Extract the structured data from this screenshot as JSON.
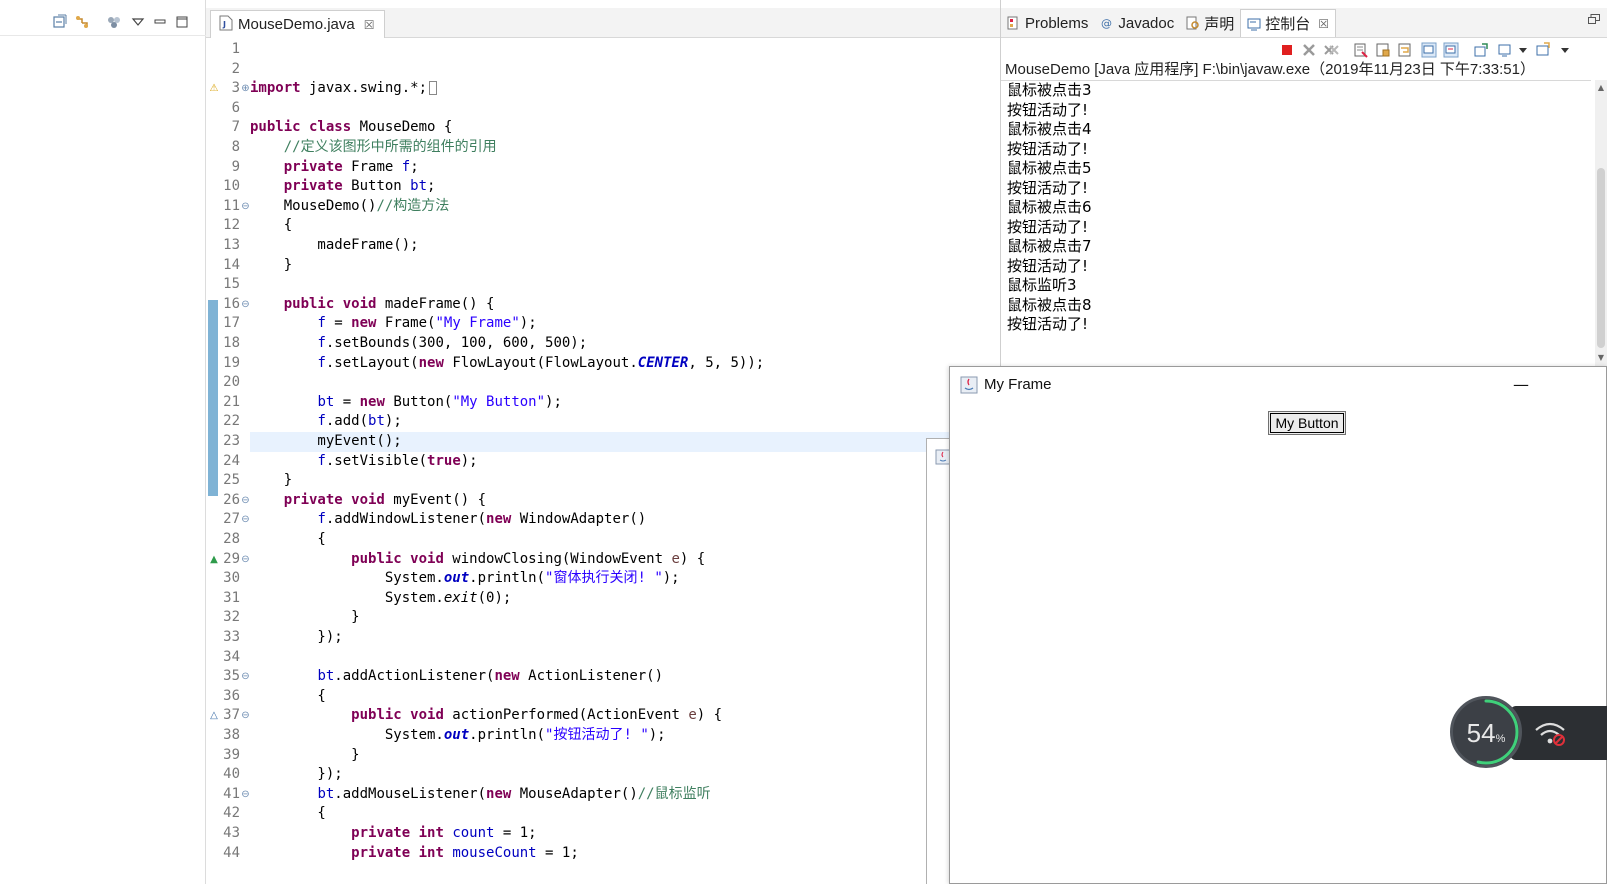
{
  "editor": {
    "tab_title": "MouseDemo.java",
    "tab_close": "☒",
    "lines": [
      {
        "n": "1",
        "tokens": []
      },
      {
        "n": "2",
        "tokens": []
      },
      {
        "n": "3",
        "fold": "⊕",
        "marker": "warn",
        "tokens": [
          {
            "t": "import",
            "c": "kw"
          },
          {
            "t": " javax.swing.*;",
            "c": "pl"
          },
          {
            "t": "",
            "c": "box"
          }
        ]
      },
      {
        "n": "6",
        "tokens": []
      },
      {
        "n": "7",
        "tokens": [
          {
            "t": "public class",
            "c": "kw"
          },
          {
            "t": " MouseDemo {",
            "c": "pl"
          }
        ]
      },
      {
        "n": "8",
        "tokens": [
          {
            "t": "    ",
            "c": "pl"
          },
          {
            "t": "//定义该图形中所需的组件的引用",
            "c": "com"
          }
        ]
      },
      {
        "n": "9",
        "tokens": [
          {
            "t": "    ",
            "c": "pl"
          },
          {
            "t": "private",
            "c": "kw"
          },
          {
            "t": " Frame ",
            "c": "pl"
          },
          {
            "t": "f",
            "c": "fld"
          },
          {
            "t": ";",
            "c": "pl"
          }
        ]
      },
      {
        "n": "10",
        "tokens": [
          {
            "t": "    ",
            "c": "pl"
          },
          {
            "t": "private",
            "c": "kw"
          },
          {
            "t": " Button ",
            "c": "pl"
          },
          {
            "t": "bt",
            "c": "fld"
          },
          {
            "t": ";",
            "c": "pl"
          }
        ]
      },
      {
        "n": "11",
        "fold": "⊖",
        "tokens": [
          {
            "t": "    MouseDemo()",
            "c": "pl"
          },
          {
            "t": "//构造方法",
            "c": "com"
          }
        ]
      },
      {
        "n": "12",
        "tokens": [
          {
            "t": "    {",
            "c": "pl"
          }
        ]
      },
      {
        "n": "13",
        "tokens": [
          {
            "t": "        madeFrame();",
            "c": "pl"
          }
        ]
      },
      {
        "n": "14",
        "tokens": [
          {
            "t": "    }",
            "c": "pl"
          }
        ]
      },
      {
        "n": "15",
        "tokens": []
      },
      {
        "n": "16",
        "fold": "⊖",
        "tokens": [
          {
            "t": "    ",
            "c": "pl"
          },
          {
            "t": "public void",
            "c": "kw"
          },
          {
            "t": " madeFrame() {",
            "c": "pl"
          }
        ]
      },
      {
        "n": "17",
        "tokens": [
          {
            "t": "        ",
            "c": "pl"
          },
          {
            "t": "f",
            "c": "fld"
          },
          {
            "t": " = ",
            "c": "pl"
          },
          {
            "t": "new",
            "c": "kw"
          },
          {
            "t": " Frame(",
            "c": "pl"
          },
          {
            "t": "\"My Frame\"",
            "c": "str"
          },
          {
            "t": ");",
            "c": "pl"
          }
        ]
      },
      {
        "n": "18",
        "tokens": [
          {
            "t": "        ",
            "c": "pl"
          },
          {
            "t": "f",
            "c": "fld"
          },
          {
            "t": ".setBounds(300, 100, 600, 500);",
            "c": "pl"
          }
        ]
      },
      {
        "n": "19",
        "tokens": [
          {
            "t": "        ",
            "c": "pl"
          },
          {
            "t": "f",
            "c": "fld"
          },
          {
            "t": ".setLayout(",
            "c": "pl"
          },
          {
            "t": "new",
            "c": "kw"
          },
          {
            "t": " FlowLayout(FlowLayout.",
            "c": "pl"
          },
          {
            "t": "CENTER",
            "c": "sfld"
          },
          {
            "t": ", 5, 5));",
            "c": "pl"
          }
        ]
      },
      {
        "n": "20",
        "tokens": []
      },
      {
        "n": "21",
        "tokens": [
          {
            "t": "        ",
            "c": "pl"
          },
          {
            "t": "bt",
            "c": "fld"
          },
          {
            "t": " = ",
            "c": "pl"
          },
          {
            "t": "new",
            "c": "kw"
          },
          {
            "t": " Button(",
            "c": "pl"
          },
          {
            "t": "\"My Button\"",
            "c": "str"
          },
          {
            "t": ");",
            "c": "pl"
          }
        ]
      },
      {
        "n": "22",
        "tokens": [
          {
            "t": "        ",
            "c": "pl"
          },
          {
            "t": "f",
            "c": "fld"
          },
          {
            "t": ".add(",
            "c": "pl"
          },
          {
            "t": "bt",
            "c": "fld"
          },
          {
            "t": ");",
            "c": "pl"
          }
        ]
      },
      {
        "n": "23",
        "current": true,
        "tokens": [
          {
            "t": "        myEvent();",
            "c": "pl"
          }
        ]
      },
      {
        "n": "24",
        "tokens": [
          {
            "t": "        ",
            "c": "pl"
          },
          {
            "t": "f",
            "c": "fld"
          },
          {
            "t": ".setVisible(",
            "c": "pl"
          },
          {
            "t": "true",
            "c": "kw"
          },
          {
            "t": ");",
            "c": "pl"
          }
        ]
      },
      {
        "n": "25",
        "tokens": [
          {
            "t": "    }",
            "c": "pl"
          }
        ]
      },
      {
        "n": "26",
        "fold": "⊖",
        "tokens": [
          {
            "t": "    ",
            "c": "pl"
          },
          {
            "t": "private void",
            "c": "kw"
          },
          {
            "t": " myEvent() {",
            "c": "pl"
          }
        ]
      },
      {
        "n": "27",
        "fold": "⊖",
        "tokens": [
          {
            "t": "        ",
            "c": "pl"
          },
          {
            "t": "f",
            "c": "fld"
          },
          {
            "t": ".addWindowListener(",
            "c": "pl"
          },
          {
            "t": "new",
            "c": "kw"
          },
          {
            "t": " WindowAdapter()",
            "c": "pl"
          }
        ]
      },
      {
        "n": "28",
        "tokens": [
          {
            "t": "        {",
            "c": "pl"
          }
        ]
      },
      {
        "n": "29",
        "fold": "⊖",
        "marker": "override",
        "tokens": [
          {
            "t": "            ",
            "c": "pl"
          },
          {
            "t": "public void",
            "c": "kw"
          },
          {
            "t": " windowClosing(WindowEvent ",
            "c": "pl"
          },
          {
            "t": "e",
            "c": "param"
          },
          {
            "t": ") {",
            "c": "pl"
          }
        ]
      },
      {
        "n": "30",
        "tokens": [
          {
            "t": "                System.",
            "c": "pl"
          },
          {
            "t": "out",
            "c": "sfld"
          },
          {
            "t": ".println(",
            "c": "pl"
          },
          {
            "t": "\"窗体执行关闭! \"",
            "c": "str"
          },
          {
            "t": ");",
            "c": "pl"
          }
        ]
      },
      {
        "n": "31",
        "tokens": [
          {
            "t": "                System.",
            "c": "pl"
          },
          {
            "t": "exit",
            "c": "sm"
          },
          {
            "t": "(0);",
            "c": "pl"
          }
        ]
      },
      {
        "n": "32",
        "tokens": [
          {
            "t": "            }",
            "c": "pl"
          }
        ]
      },
      {
        "n": "33",
        "tokens": [
          {
            "t": "        });",
            "c": "pl"
          }
        ]
      },
      {
        "n": "34",
        "tokens": []
      },
      {
        "n": "35",
        "fold": "⊖",
        "tokens": [
          {
            "t": "        ",
            "c": "pl"
          },
          {
            "t": "bt",
            "c": "fld"
          },
          {
            "t": ".addActionListener(",
            "c": "pl"
          },
          {
            "t": "new",
            "c": "kw"
          },
          {
            "t": " ActionListener()",
            "c": "pl"
          }
        ]
      },
      {
        "n": "36",
        "tokens": [
          {
            "t": "        {",
            "c": "pl"
          }
        ]
      },
      {
        "n": "37",
        "fold": "⊖",
        "marker": "implement",
        "tokens": [
          {
            "t": "            ",
            "c": "pl"
          },
          {
            "t": "public void",
            "c": "kw"
          },
          {
            "t": " actionPerformed(ActionEvent ",
            "c": "pl"
          },
          {
            "t": "e",
            "c": "param"
          },
          {
            "t": ") {",
            "c": "pl"
          }
        ]
      },
      {
        "n": "38",
        "tokens": [
          {
            "t": "                System.",
            "c": "pl"
          },
          {
            "t": "out",
            "c": "sfld"
          },
          {
            "t": ".println(",
            "c": "pl"
          },
          {
            "t": "\"按钮活动了! \"",
            "c": "str"
          },
          {
            "t": ");",
            "c": "pl"
          }
        ]
      },
      {
        "n": "39",
        "tokens": [
          {
            "t": "            }",
            "c": "pl"
          }
        ]
      },
      {
        "n": "40",
        "tokens": [
          {
            "t": "        });",
            "c": "pl"
          }
        ]
      },
      {
        "n": "41",
        "fold": "⊖",
        "tokens": [
          {
            "t": "        ",
            "c": "pl"
          },
          {
            "t": "bt",
            "c": "fld"
          },
          {
            "t": ".addMouseListener(",
            "c": "pl"
          },
          {
            "t": "new",
            "c": "kw"
          },
          {
            "t": " MouseAdapter()",
            "c": "pl"
          },
          {
            "t": "//鼠标监听",
            "c": "com"
          }
        ]
      },
      {
        "n": "42",
        "tokens": [
          {
            "t": "        {",
            "c": "pl"
          }
        ]
      },
      {
        "n": "43",
        "tokens": [
          {
            "t": "            ",
            "c": "pl"
          },
          {
            "t": "private int",
            "c": "kw"
          },
          {
            "t": " ",
            "c": "pl"
          },
          {
            "t": "count",
            "c": "fld"
          },
          {
            "t": " = 1;",
            "c": "pl"
          }
        ]
      },
      {
        "n": "44",
        "tokens": [
          {
            "t": "            ",
            "c": "pl"
          },
          {
            "t": "private int",
            "c": "kw"
          },
          {
            "t": " ",
            "c": "pl"
          },
          {
            "t": "mouseCount",
            "c": "fld"
          },
          {
            "t": " = 1;",
            "c": "pl"
          }
        ]
      }
    ]
  },
  "console": {
    "tabs": [
      {
        "label": "Problems",
        "name": "problems"
      },
      {
        "label": "Javadoc",
        "name": "javadoc"
      },
      {
        "label": "声明",
        "name": "declaration"
      },
      {
        "label": "控制台",
        "name": "console",
        "active": true
      }
    ],
    "tab_close": "☒",
    "description": "MouseDemo [Java 应用程序] F:\\bin\\javaw.exe（2019年11月23日 下午7:33:51）",
    "output": [
      "鼠标被点击3",
      "按钮活动了!",
      "鼠标被点击4",
      "按钮活动了!",
      "鼠标被点击5",
      "按钮活动了!",
      "鼠标被点击6",
      "按钮活动了!",
      "鼠标被点击7",
      "按钮活动了!",
      "鼠标监听3",
      "鼠标被点击8",
      "按钮活动了!"
    ]
  },
  "frame": {
    "title": "My Frame",
    "minimize": "—",
    "button_label": "My Button"
  },
  "widget": {
    "value": "54",
    "unit": "%"
  },
  "colors": {
    "keyword": "#7f0055",
    "string": "#2a00ff",
    "comment": "#3f7f5f",
    "field": "#0000c0",
    "current_line": "#e8f2fe",
    "change_bar": "#7fb3d5"
  }
}
